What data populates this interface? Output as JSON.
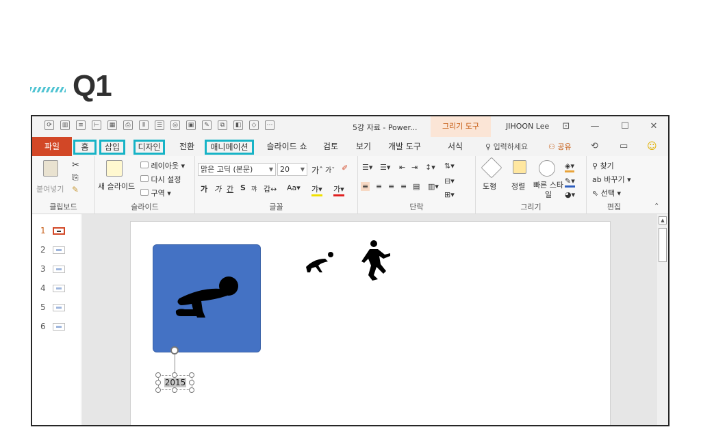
{
  "heading": {
    "title": "Q1"
  },
  "titlebar": {
    "document_title": "5강 자료 - Power...",
    "context_tab": "그리기 도구",
    "user": "JIHOON Lee",
    "minimize": "—",
    "maximize": "☐",
    "close": "✕"
  },
  "tabs": {
    "file": "파일",
    "home": "홈",
    "insert": "삽입",
    "design": "디자인",
    "transitions": "전환",
    "animations": "애니메이션",
    "slideshow": "슬라이드 쇼",
    "review": "검토",
    "view": "보기",
    "developer": "개발 도구",
    "format": "서식",
    "tell_me": "입력하세요",
    "share": "공유"
  },
  "ribbon": {
    "clipboard": {
      "label": "클립보드",
      "paste": "붙여넣기"
    },
    "slides": {
      "label": "슬라이드",
      "new_slide": "새 슬라이드",
      "layout": "레이아웃",
      "reset": "다시 설정",
      "section": "구역"
    },
    "font": {
      "label": "글꼴",
      "font_name": "맑은 고딕 (본문)",
      "font_size": "20"
    },
    "paragraph": {
      "label": "단락"
    },
    "drawing": {
      "label": "그리기",
      "shapes": "도형",
      "arrange": "정렬",
      "quick_styles": "빠른 스타일"
    },
    "editing": {
      "label": "편집",
      "find": "찾기",
      "replace": "바꾸기",
      "select": "선택"
    }
  },
  "slides_panel": [
    {
      "num": "1"
    },
    {
      "num": "2"
    },
    {
      "num": "3"
    },
    {
      "num": "4"
    },
    {
      "num": "5"
    },
    {
      "num": "6"
    }
  ],
  "slide": {
    "textbox_text": "2015"
  },
  "colors": {
    "accent": "#17b3c6",
    "file_tab": "#d24726",
    "shape_fill": "#4472c4"
  }
}
